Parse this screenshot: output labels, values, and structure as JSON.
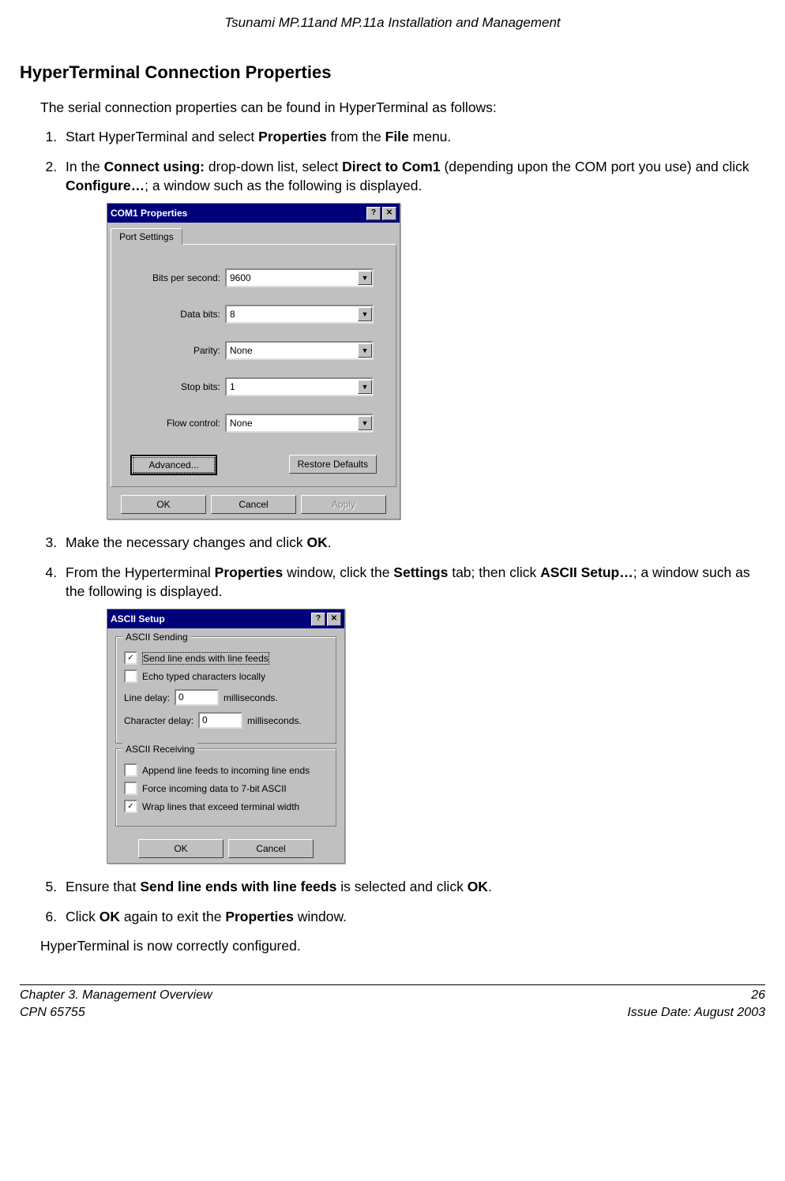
{
  "header": {
    "running_title": "Tsunami MP.11and MP.11a Installation and Management"
  },
  "section": {
    "heading": "HyperTerminal Connection Properties"
  },
  "intro": "The serial connection properties can be found in HyperTerminal as follows:",
  "steps": {
    "s1": {
      "pre": "Start HyperTerminal and select ",
      "b1": "Properties",
      "mid": " from the ",
      "b2": "File",
      "post": " menu."
    },
    "s2": {
      "pre": "In the ",
      "b1": "Connect using:",
      "mid1": " drop-down list, select ",
      "b2": "Direct to Com1",
      "mid2": " (depending upon the COM port you use) and click ",
      "b3": "Configure…",
      "post": "; a window such as the following is displayed."
    },
    "s3": {
      "pre": "Make the necessary changes and click ",
      "b1": "OK",
      "post": "."
    },
    "s4": {
      "pre": "From the Hyperterminal ",
      "b1": "Properties",
      "mid1": " window, click the ",
      "b2": "Settings",
      "mid2": " tab; then click ",
      "b3": "ASCII Setup…",
      "post": "; a window such as the following is displayed."
    },
    "s5": {
      "pre": "Ensure that ",
      "b1": "Send line ends with line feeds",
      "mid": " is selected and click ",
      "b2": "OK",
      "post": "."
    },
    "s6": {
      "pre": "Click ",
      "b1": "OK",
      "mid": " again to exit the ",
      "b2": "Properties",
      "post": " window."
    }
  },
  "closing": "HyperTerminal is now correctly configured.",
  "com1_dialog": {
    "title": "COM1 Properties",
    "tab": "Port Settings",
    "fields": {
      "bps": {
        "label": "Bits per second:",
        "value": "9600"
      },
      "databits": {
        "label": "Data bits:",
        "value": "8"
      },
      "parity": {
        "label": "Parity:",
        "value": "None"
      },
      "stopbits": {
        "label": "Stop bits:",
        "value": "1"
      },
      "flow": {
        "label": "Flow control:",
        "value": "None"
      }
    },
    "buttons": {
      "advanced": "Advanced...",
      "restore": "Restore Defaults",
      "ok": "OK",
      "cancel": "Cancel",
      "apply": "Apply"
    }
  },
  "ascii_dialog": {
    "title": "ASCII Setup",
    "group_send": "ASCII Sending",
    "group_recv": "ASCII Receiving",
    "send_line_ends": "Send line ends with line feeds",
    "echo": "Echo typed characters locally",
    "line_delay_label": "Line delay:",
    "char_delay_label": "Character delay:",
    "line_delay_value": "0",
    "char_delay_value": "0",
    "ms": "milliseconds.",
    "append": "Append line feeds to incoming line ends",
    "force": "Force incoming data to 7-bit ASCII",
    "wrap": "Wrap lines that exceed terminal width",
    "ok": "OK",
    "cancel": "Cancel",
    "checked": {
      "send_line_ends": true,
      "echo": false,
      "append": false,
      "force": false,
      "wrap": true
    }
  },
  "footer": {
    "chapter": "Chapter 3.  Management Overview",
    "cpn": "CPN 65755",
    "page": "26",
    "issue": "Issue Date:  August 2003"
  },
  "icons": {
    "help": "?",
    "close": "✕",
    "down": "▼",
    "check": "✓"
  }
}
